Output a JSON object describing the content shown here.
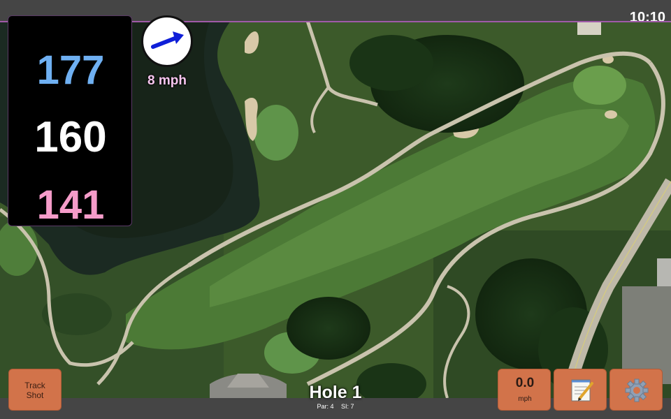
{
  "status_bar": {
    "time": "10:10"
  },
  "distances": {
    "back": "177",
    "middle": "160",
    "front": "141"
  },
  "wind": {
    "speed_label": "8 mph",
    "icon": "wind-arrow-icon"
  },
  "hole": {
    "title": "Hole 1",
    "par": "Par: 4",
    "stroke_index": "SI: 7"
  },
  "buttons": {
    "track_shot": {
      "line1": "Track",
      "line2": "Shot"
    },
    "wind_speed": {
      "value": "0.0",
      "unit": "mph"
    },
    "notes": {
      "icon": "notepad-icon"
    },
    "settings": {
      "icon": "gear-icon"
    }
  },
  "colors": {
    "back_distance": "#6fb0f2",
    "middle_distance": "#ffffff",
    "front_distance": "#f59cc9",
    "button": "#d2734a"
  }
}
